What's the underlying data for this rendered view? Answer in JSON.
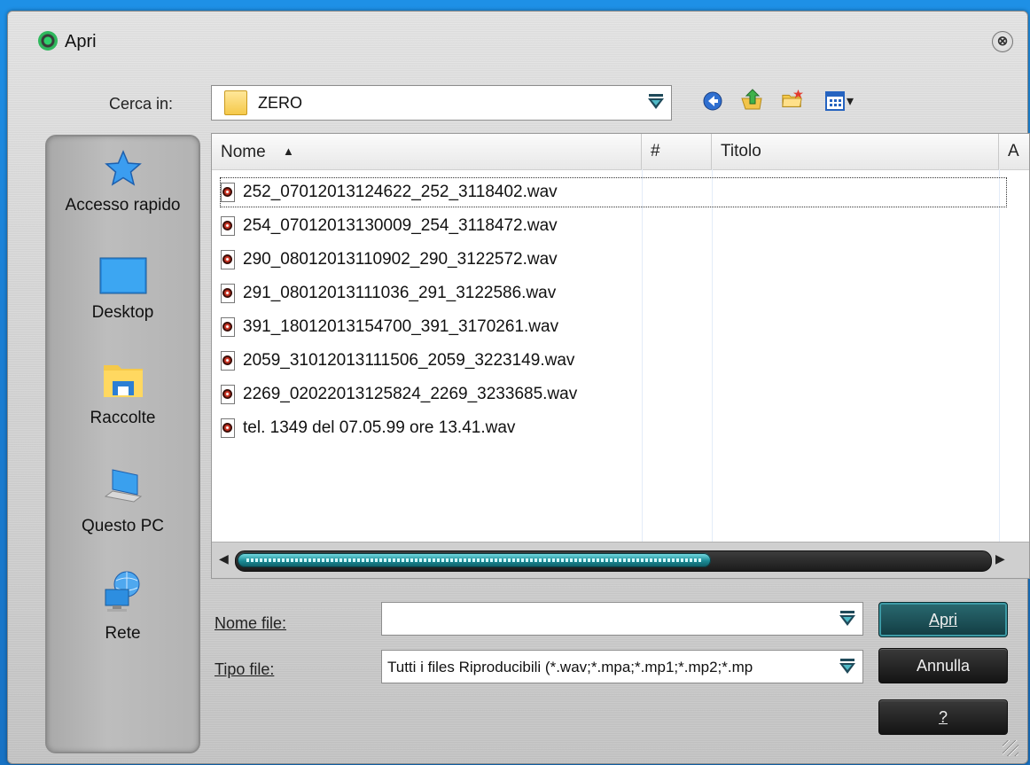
{
  "window": {
    "title": "Apri",
    "close_glyph": "⊗"
  },
  "lookin": {
    "label": "Cerca in:",
    "value": "ZERO"
  },
  "toolbar": {
    "back_icon": "back-arrow-icon",
    "up_icon": "folder-up-icon",
    "newfolder_icon": "new-folder-icon",
    "view_icon": "view-menu-icon",
    "view_caret": "▾"
  },
  "places": [
    {
      "label": "Accesso rapido",
      "icon": "star-icon"
    },
    {
      "label": "Desktop",
      "icon": "desktop-icon"
    },
    {
      "label": "Raccolte",
      "icon": "libraries-icon"
    },
    {
      "label": "Questo PC",
      "icon": "computer-icon"
    },
    {
      "label": "Rete",
      "icon": "network-icon"
    }
  ],
  "columns": [
    {
      "label": "Nome",
      "sort": "▲"
    },
    {
      "label": "#"
    },
    {
      "label": "Titolo"
    },
    {
      "label": "A"
    }
  ],
  "files": [
    "252_07012013124622_252_3118402.wav",
    "254_07012013130009_254_3118472.wav",
    "290_08012013110902_290_3122572.wav",
    "291_08012013111036_291_3122586.wav",
    "391_18012013154700_391_3170261.wav",
    "2059_31012013111506_2059_3223149.wav",
    "2269_02022013125824_2269_3233685.wav",
    "tel. 1349 del 07.05.99 ore 13.41.wav"
  ],
  "scroll": {
    "left": "◀",
    "right": "▶",
    "thumb_fraction": 0.63
  },
  "filename": {
    "label": "Nome file:",
    "value": ""
  },
  "filetype": {
    "label": "Tipo file:",
    "value": "Tutti i files Riproducibili (*.wav;*.mpa;*.mp1;*.mp2;*.mp"
  },
  "buttons": {
    "open": "Apri",
    "cancel": "Annulla",
    "help": "?"
  },
  "colors": {
    "accent": "#1b8a95",
    "bg_blue": "#1a7fd4"
  }
}
